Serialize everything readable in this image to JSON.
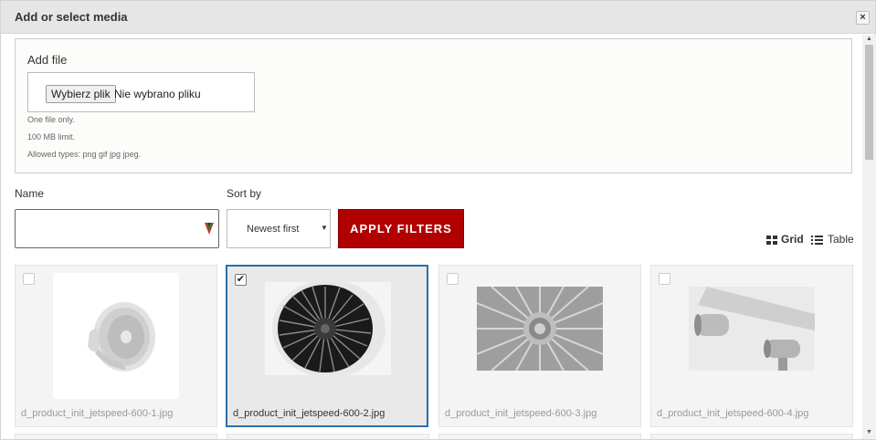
{
  "dialog": {
    "title": "Add or select media",
    "close_label": "×"
  },
  "upload": {
    "label": "Add file",
    "choose_button": "Wybierz plik",
    "file_status": "Nie wybrano pliku",
    "hints": [
      "One file only.",
      "100 MB limit.",
      "Allowed types: png gif jpg jpeg."
    ]
  },
  "filters": {
    "name_label": "Name",
    "name_value": "",
    "sort_label": "Sort by",
    "sort_value": "Newest first",
    "apply_button": "APPLY FILTERS"
  },
  "view": {
    "grid_label": "Grid",
    "table_label": "Table",
    "active": "Grid"
  },
  "media": [
    {
      "filename": "d_product_init_jetspeed-600-1.jpg",
      "selected": false
    },
    {
      "filename": "d_product_init_jetspeed-600-2.jpg",
      "selected": true
    },
    {
      "filename": "d_product_init_jetspeed-600-3.jpg",
      "selected": false
    },
    {
      "filename": "d_product_init_jetspeed-600-4.jpg",
      "selected": false
    }
  ],
  "colors": {
    "apply_button": "#b00000",
    "selected_border": "#2a6fa8",
    "titlebar": "#e6e6e6"
  }
}
